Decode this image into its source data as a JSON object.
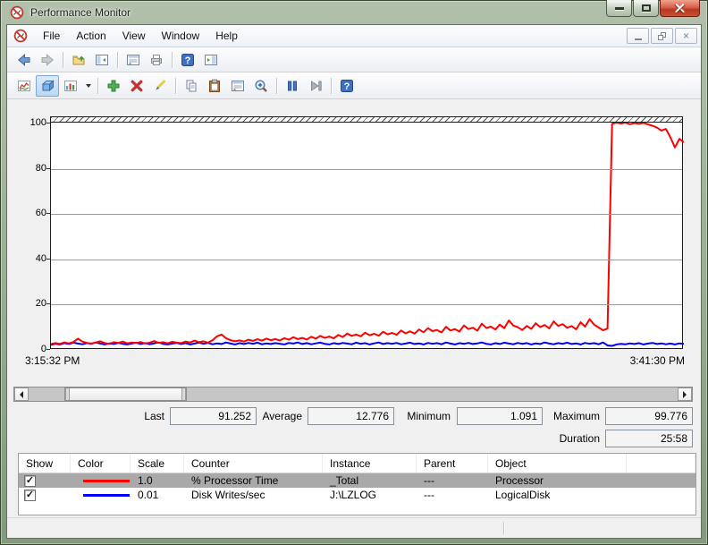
{
  "window": {
    "title": "Performance Monitor"
  },
  "window_controls": [
    "minimize",
    "maximize",
    "close"
  ],
  "menu": {
    "items": [
      "File",
      "Action",
      "View",
      "Window",
      "Help"
    ]
  },
  "mdi_controls": [
    "minimize",
    "restore",
    "close"
  ],
  "toolbar_standard": {
    "buttons": [
      {
        "name": "back",
        "icon": "arrow-left"
      },
      {
        "name": "forward",
        "icon": "arrow-right",
        "disabled": true
      },
      {
        "sep": true
      },
      {
        "name": "up-one-level",
        "icon": "folder-up"
      },
      {
        "name": "show-hide-console-tree",
        "icon": "console-tree"
      },
      {
        "sep": true
      },
      {
        "name": "export-list",
        "icon": "properties-dialog"
      },
      {
        "name": "print",
        "icon": "printer"
      },
      {
        "sep": true
      },
      {
        "name": "help",
        "icon": "help"
      },
      {
        "name": "show-hide-action-pane",
        "icon": "action-pane"
      }
    ]
  },
  "toolbar_perfmon": {
    "buttons": [
      {
        "name": "view-current-activity",
        "icon": "chart-line"
      },
      {
        "name": "view-log-data",
        "icon": "log-cube",
        "pressed": true
      },
      {
        "name": "change-graph-type",
        "icon": "graph-type",
        "caret": true
      },
      {
        "sep": true
      },
      {
        "name": "add-counter",
        "icon": "add-plus"
      },
      {
        "name": "delete-counter",
        "icon": "delete-x"
      },
      {
        "name": "highlight",
        "icon": "highlight-pen"
      },
      {
        "sep": true
      },
      {
        "name": "copy-properties",
        "icon": "copy"
      },
      {
        "name": "paste-counter-list",
        "icon": "paste"
      },
      {
        "name": "properties",
        "icon": "properties-dialog"
      },
      {
        "name": "zoom",
        "icon": "zoom-magnifier"
      },
      {
        "sep": true
      },
      {
        "name": "freeze-display",
        "icon": "pause"
      },
      {
        "name": "update-data",
        "icon": "step-forward",
        "disabled": true
      },
      {
        "sep": true
      },
      {
        "name": "help",
        "icon": "help"
      }
    ]
  },
  "chart_data": {
    "type": "line",
    "title": "",
    "ylim": [
      0,
      100
    ],
    "yticks": [
      0,
      20,
      40,
      60,
      80,
      100
    ],
    "grid": "horizontal",
    "x_start_label": "3:15:32 PM",
    "x_end_label": "3:41:30 PM",
    "legend_position": "table-below",
    "series": [
      {
        "name": "% Processor Time",
        "color": "#ff0000",
        "scale": "1.0",
        "instance": "_Total",
        "object": "Processor",
        "values": [
          2.2,
          2.6,
          2.3,
          2.9,
          2.5,
          3.1,
          4.6,
          3.3,
          2.7,
          2.4,
          2.9,
          3.4,
          2.6,
          2.3,
          3.0,
          2.7,
          3.3,
          2.5,
          2.9,
          2.6,
          3.1,
          2.4,
          2.8,
          3.5,
          2.7,
          3.0,
          2.5,
          3.2,
          2.8,
          2.6,
          3.3,
          2.9,
          3.7,
          3.0,
          3.4,
          2.8,
          3.9,
          5.6,
          6.4,
          4.8,
          3.9,
          3.4,
          3.8,
          3.3,
          4.1,
          3.6,
          4.3,
          3.7,
          4.6,
          3.9,
          4.4,
          3.8,
          4.8,
          4.1,
          5.2,
          4.4,
          4.9,
          4.2,
          5.4,
          4.6,
          5.8,
          4.9,
          5.5,
          4.7,
          6.2,
          5.3,
          6.8,
          5.8,
          6.4,
          5.6,
          7.2,
          6.1,
          6.7,
          5.9,
          7.6,
          6.5,
          7.1,
          6.3,
          8.2,
          6.9,
          7.8,
          6.8,
          8.6,
          7.4,
          9.2,
          7.9,
          8.4,
          7.3,
          9.8,
          8.2,
          8.8,
          7.7,
          10.4,
          8.8,
          9.4,
          8.1,
          11.2,
          9.3,
          9.9,
          8.6,
          10.8,
          9.2,
          12.6,
          10.4,
          9.6,
          8.4,
          10.2,
          8.9,
          11.4,
          9.7,
          10.6,
          9.1,
          12.2,
          10.2,
          11.0,
          9.4,
          10.1,
          8.7,
          11.8,
          9.9,
          13.2,
          10.8,
          9.5,
          8.3,
          9.0,
          99.5,
          100,
          99.6,
          100,
          99.3,
          99.8,
          99.5,
          99.9,
          99.2,
          98.6,
          97.8,
          96.5,
          97.2,
          93.5,
          89.0,
          92.8,
          91.3
        ]
      },
      {
        "name": "Disk Writes/sec",
        "color": "#0000ff",
        "scale": "0.01",
        "instance": "J:\\LZLOG",
        "object": "LogicalDisk",
        "values": [
          1.8,
          2.3,
          2.0,
          2.6,
          2.2,
          2.8,
          2.4,
          2.1,
          2.6,
          2.3,
          2.9,
          2.4,
          2.0,
          2.5,
          2.2,
          2.7,
          2.3,
          2.0,
          2.4,
          2.8,
          2.2,
          2.6,
          2.1,
          2.5,
          2.9,
          2.3,
          2.0,
          2.4,
          2.7,
          2.2,
          2.6,
          2.0,
          2.4,
          2.8,
          2.3,
          2.7,
          2.1,
          2.5,
          2.2,
          2.9,
          2.4,
          2.0,
          2.6,
          2.2,
          2.7,
          2.3,
          2.8,
          2.1,
          2.5,
          2.2,
          2.6,
          2.3,
          2.0,
          2.7,
          2.4,
          2.9,
          2.2,
          2.6,
          2.1,
          2.5,
          2.8,
          2.3,
          2.0,
          2.6,
          2.2,
          2.7,
          2.4,
          2.1,
          2.8,
          2.3,
          2.6,
          2.0,
          2.5,
          2.9,
          2.2,
          2.6,
          2.3,
          2.7,
          2.1,
          2.4,
          2.8,
          2.2,
          2.5,
          2.0,
          2.7,
          2.3,
          2.6,
          2.1,
          2.9,
          2.4,
          2.0,
          2.6,
          2.3,
          2.7,
          2.2,
          2.5,
          2.9,
          2.3,
          2.0,
          2.6,
          2.2,
          2.8,
          2.4,
          2.1,
          2.7,
          2.3,
          2.6,
          2.0,
          2.5,
          2.2,
          2.9,
          2.4,
          2.1,
          2.6,
          2.3,
          2.8,
          2.2,
          2.5,
          2.0,
          2.7,
          2.3,
          2.6,
          2.1,
          2.9,
          1.6,
          1.4,
          2.0,
          2.3,
          2.1,
          2.5,
          2.2,
          2.6,
          2.0,
          2.4,
          2.7,
          2.2,
          2.5,
          2.1,
          2.4,
          2.0,
          2.5,
          2.3
        ]
      }
    ]
  },
  "stats": {
    "last_label": "Last",
    "last_value": "91.252",
    "average_label": "Average",
    "average_value": "12.776",
    "minimum_label": "Minimum",
    "minimum_value": "1.091",
    "maximum_label": "Maximum",
    "maximum_value": "99.776",
    "duration_label": "Duration",
    "duration_value": "25:58"
  },
  "counter_table": {
    "headers": [
      "Show",
      "Color",
      "Scale",
      "Counter",
      "Instance",
      "Parent",
      "Object"
    ],
    "rows": [
      {
        "show": true,
        "color": "#ff0000",
        "scale": "1.0",
        "counter": "% Processor Time",
        "instance": "_Total",
        "parent": "---",
        "object": "Processor",
        "selected": true
      },
      {
        "show": true,
        "color": "#0000ff",
        "scale": "0.01",
        "counter": "Disk Writes/sec",
        "instance": "J:\\LZLOG",
        "parent": "---",
        "object": "LogicalDisk",
        "selected": false
      }
    ]
  },
  "colors": {
    "selected_row": "#a9a9a9",
    "pane_bg": "#f0f0f0",
    "chart_bg": "#ffffff"
  }
}
